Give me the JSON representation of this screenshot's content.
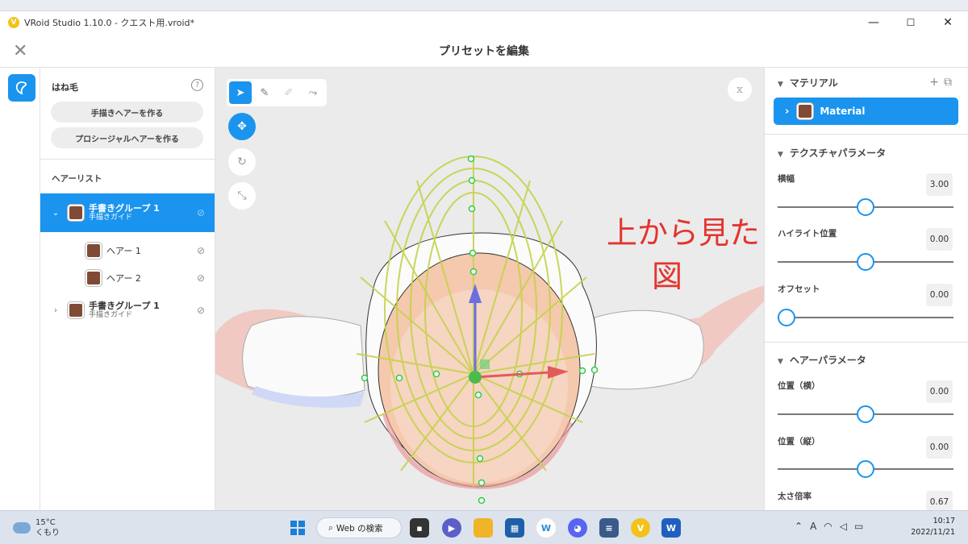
{
  "window": {
    "title": "VRoid Studio 1.10.0 - クエスト用.vroid*",
    "minimize": "—",
    "maximize": "☐",
    "close": "✕"
  },
  "header": {
    "title": "プリセットを編集",
    "close_icon": "✕"
  },
  "left_panel": {
    "title": "はね毛",
    "help": "?",
    "buttons": [
      "手描きヘアーを作る",
      "プロシージャルヘアーを作る"
    ],
    "section_title": "ヘアーリスト",
    "hair_list": [
      {
        "name": "手書きグループ 1",
        "sub": "手描きガイド",
        "expanded": true,
        "selected": true
      },
      {
        "name": "ヘアー 1",
        "child": true
      },
      {
        "name": "ヘアー 2",
        "child": true
      },
      {
        "name": "手書きグループ 1",
        "sub": "手描きガイド",
        "expanded": false,
        "selected": false
      }
    ],
    "swatch_color": "#7f4b37"
  },
  "viewport": {
    "annotation_line1": "上から見た",
    "annotation_line2": "図"
  },
  "right_panel": {
    "material_section": "マテリアル",
    "material_name": "Material",
    "texture_section": "テクスチャパラメータ",
    "texture_params": [
      {
        "label": "横幅",
        "value": "3.00",
        "pos": 0.5
      },
      {
        "label": "ハイライト位置",
        "value": "0.00",
        "pos": 0.5
      },
      {
        "label": "オフセット",
        "value": "0.00",
        "pos": 0.0
      }
    ],
    "hair_section": "ヘアーパラメータ",
    "hair_params": [
      {
        "label": "位置（横）",
        "value": "0.00",
        "pos": 0.5
      },
      {
        "label": "位置（縦）",
        "value": "0.00",
        "pos": 0.5
      },
      {
        "label": "太さ倍率",
        "value": "0.67"
      }
    ]
  },
  "taskbar": {
    "temperature": "15°C",
    "weather": "くもり",
    "search_label": "Web の検索",
    "time": "10:17",
    "date": "2022/11/21",
    "ime": "A"
  },
  "colors": {
    "accent": "#1a94ee",
    "annotation": "#e3342f"
  }
}
